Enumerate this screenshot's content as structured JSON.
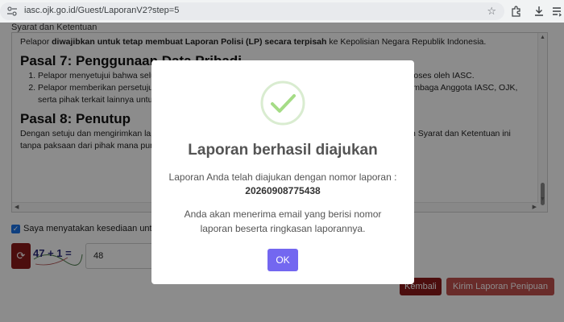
{
  "browser": {
    "url": "iasc.ojk.go.id/Guest/LaporanV2?step=5",
    "icons": [
      "tune-icon",
      "star-icon",
      "extensions-icon",
      "download-icon",
      "menu-icon"
    ]
  },
  "page": {
    "section_heading": "Syarat dan Ketentuan",
    "tos_lead_prefix": "Pelapor ",
    "tos_lead_bold": "diwajibkan untuk tetap membuat Laporan Polisi (LP) secara terpisah",
    "tos_lead_suffix": " ke Kepolisian Negara Republik Indonesia.",
    "pasal7_title": "Pasal 7: Penggunaan Data Pribadi",
    "pasal7_item1": "Pelapor menyetujui bahwa seluruh data yang disampaikan dalam laporan ini akan disimpan dan diproses oleh IASC.",
    "pasal7_item2": "Pelapor memberikan persetujuan kepada IASC untuk membagikan data laporan tersebut kepada Lembaga Anggota IASC, OJK, serta pihak terkait lainnya untuk tindak lanjut, penelusuran, dan penanganan laporan.",
    "pasal8_title": "Pasal 8: Penutup",
    "pasal8_text": "Dengan setuju dan mengirimkan laporan ini, Pelapor menyatakan telah membaca dan menyetujui seluruh Syarat dan Ketentuan ini tanpa paksaan dari pihak mana pun.",
    "agree_label": "Saya menyatakan kesediaan untuk",
    "captcha_text": "47 + 1 =",
    "captcha_answer": "48",
    "back_button": "Kembali",
    "submit_button": "Kirim Laporan Penipuan"
  },
  "modal": {
    "title": "Laporan berhasil diajukan",
    "line1": "Laporan Anda telah diajukan dengan nomor laporan :",
    "report_number": "20260908775438",
    "line2": "Anda akan menerima email yang berisi nomor laporan beserta ringkasan laporannya.",
    "ok_button": "OK"
  },
  "colors": {
    "accent": "#7367f0",
    "success": "#a5dc86",
    "danger": "#8b1a1a",
    "submit": "#c0504d"
  }
}
